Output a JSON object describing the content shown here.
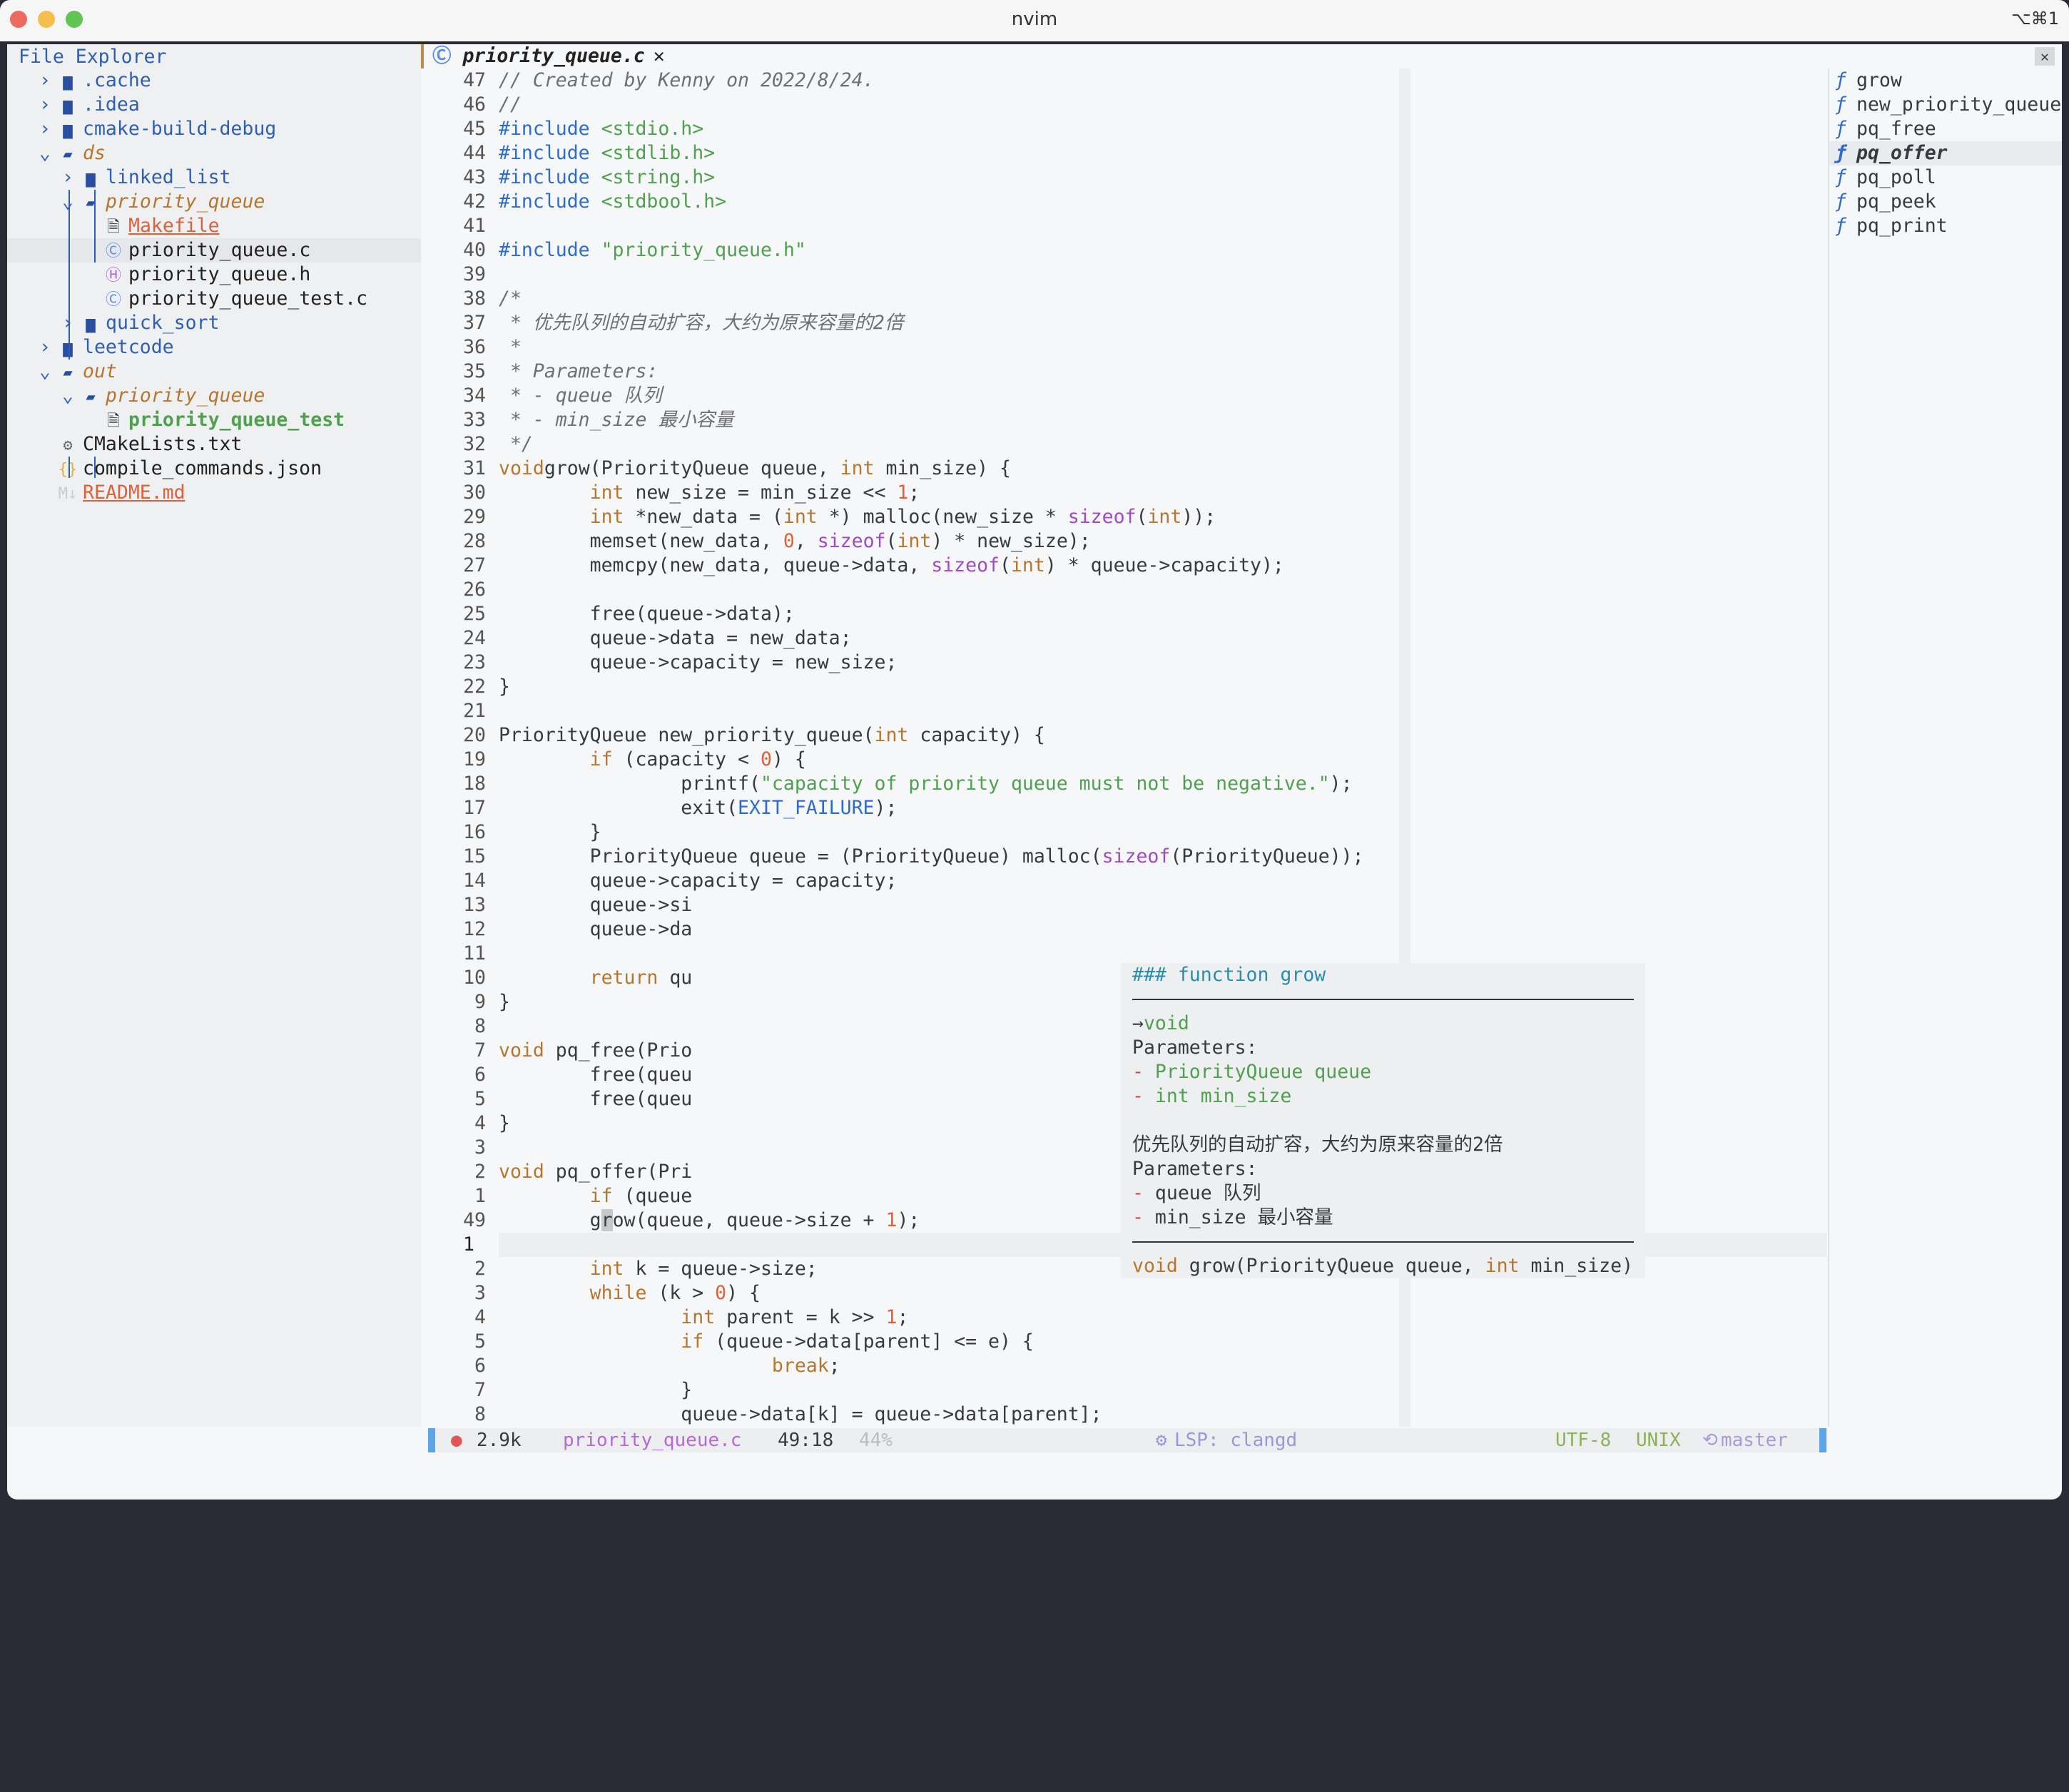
{
  "window": {
    "title": "nvim",
    "shortcut": "⌥⌘1",
    "lights": [
      "#ed6a5e",
      "#f5bf4f",
      "#61c554"
    ]
  },
  "explorer": {
    "title": "File Explorer",
    "items": [
      {
        "label": ".cache",
        "depth": 0,
        "chevron": "›",
        "icon": "folder",
        "color": "#2f5fb3"
      },
      {
        "label": ".idea",
        "depth": 0,
        "chevron": "›",
        "icon": "folder",
        "color": "#2f5fb3"
      },
      {
        "label": "cmake-build-debug",
        "depth": 0,
        "chevron": "›",
        "icon": "folder",
        "color": "#2f5fb3"
      },
      {
        "label": "ds",
        "depth": 0,
        "chevron": "⌄",
        "icon": "folder-open",
        "color": "#b7762e",
        "italic": true
      },
      {
        "label": "linked_list",
        "depth": 1,
        "chevron": "›",
        "icon": "folder",
        "color": "#2f5fb3"
      },
      {
        "label": "priority_queue",
        "depth": 1,
        "chevron": "⌄",
        "icon": "folder-open",
        "color": "#b7762e",
        "italic": true
      },
      {
        "label": "Makefile",
        "depth": 2,
        "chevron": "",
        "icon": "file",
        "color": "#e0603a",
        "underline": true
      },
      {
        "label": "priority_queue.c",
        "depth": 2,
        "chevron": "",
        "icon": "c-file",
        "color": "#222",
        "selected": true
      },
      {
        "label": "priority_queue.h",
        "depth": 2,
        "chevron": "",
        "icon": "h-file",
        "color": "#222"
      },
      {
        "label": "priority_queue_test.c",
        "depth": 2,
        "chevron": "",
        "icon": "c-file",
        "color": "#222"
      },
      {
        "label": "quick_sort",
        "depth": 1,
        "chevron": "›",
        "icon": "folder",
        "color": "#2f5fb3"
      },
      {
        "label": "leetcode",
        "depth": 0,
        "chevron": "›",
        "icon": "folder",
        "color": "#2f5fb3"
      },
      {
        "label": "out",
        "depth": 0,
        "chevron": "⌄",
        "icon": "folder-open",
        "color": "#b7762e",
        "italic": true
      },
      {
        "label": "priority_queue",
        "depth": 1,
        "chevron": "⌄",
        "icon": "folder-open",
        "color": "#b7762e",
        "italic": true
      },
      {
        "label": "priority_queue_test",
        "depth": 2,
        "chevron": "",
        "icon": "file",
        "color": "#50a14f",
        "bold": true
      },
      {
        "label": "CMakeLists.txt",
        "depth": 0,
        "chevron": "",
        "icon": "gear",
        "color": "#222"
      },
      {
        "label": "compile_commands.json",
        "depth": 0,
        "chevron": "",
        "icon": "json",
        "color": "#222"
      },
      {
        "label": "README.md",
        "depth": 0,
        "chevron": "",
        "icon": "markdown",
        "color": "#e0603a",
        "underline": true
      }
    ]
  },
  "tab": {
    "label": "priority_queue.c",
    "close": "✕",
    "close_all": "✕"
  },
  "code": {
    "current_index": 48,
    "lines": [
      {
        "n": "47",
        "t": [
          [
            "c",
            "// Created by Kenny on 2022/8/24."
          ]
        ]
      },
      {
        "n": "46",
        "t": [
          [
            "c",
            "//"
          ]
        ]
      },
      {
        "n": "45",
        "t": [
          [
            "p",
            "#include"
          ],
          [
            "s",
            " <stdio.h>"
          ]
        ]
      },
      {
        "n": "44",
        "t": [
          [
            "p",
            "#include"
          ],
          [
            "s",
            " <stdlib.h>"
          ]
        ]
      },
      {
        "n": "43",
        "t": [
          [
            "p",
            "#include"
          ],
          [
            "s",
            " <string.h>"
          ]
        ]
      },
      {
        "n": "42",
        "t": [
          [
            "p",
            "#include"
          ],
          [
            "s",
            " <stdbool.h>"
          ]
        ]
      },
      {
        "n": "41",
        "t": []
      },
      {
        "n": "40",
        "t": [
          [
            "p",
            "#include"
          ],
          [
            "s",
            " \"priority_queue.h\""
          ]
        ]
      },
      {
        "n": "39",
        "t": []
      },
      {
        "n": "38",
        "t": [
          [
            "c",
            "/*"
          ]
        ]
      },
      {
        "n": "37",
        "t": [
          [
            "c",
            " * 优先队列的自动扩容，大约为原来容量的2倍"
          ]
        ]
      },
      {
        "n": "36",
        "t": [
          [
            "c",
            " *"
          ]
        ]
      },
      {
        "n": "35",
        "t": [
          [
            "c",
            " * Parameters:"
          ]
        ]
      },
      {
        "n": "34",
        "t": [
          [
            "c",
            " * - queue 队列"
          ]
        ]
      },
      {
        "n": "33",
        "t": [
          [
            "c",
            " * - min_size 最小容量"
          ]
        ]
      },
      {
        "n": "32",
        "t": [
          [
            "c",
            " */"
          ]
        ]
      },
      {
        "n": "31",
        "t": [
          [
            "k",
            "void"
          ],
          [
            "",
            "grow(PriorityQueue queue, "
          ],
          [
            "k",
            "int"
          ],
          [
            "",
            " min_size) {"
          ]
        ]
      },
      {
        "n": "30",
        "t": [
          [
            "",
            "        "
          ],
          [
            "k",
            "int"
          ],
          [
            "",
            " new_size = min_size << "
          ],
          [
            "n",
            "1"
          ],
          [
            "",
            ";"
          ]
        ]
      },
      {
        "n": "29",
        "t": [
          [
            "",
            "        "
          ],
          [
            "k",
            "int"
          ],
          [
            "",
            " *new_data = ("
          ],
          [
            "k",
            "int"
          ],
          [
            "",
            " *) malloc(new_size * "
          ],
          [
            "b",
            "sizeof"
          ],
          [
            "",
            "("
          ],
          [
            "k",
            "int"
          ],
          [
            "",
            "));"
          ]
        ]
      },
      {
        "n": "28",
        "t": [
          [
            "",
            "        memset(new_data, "
          ],
          [
            "n",
            "0"
          ],
          [
            "",
            ", "
          ],
          [
            "b",
            "sizeof"
          ],
          [
            "",
            "("
          ],
          [
            "k",
            "int"
          ],
          [
            "",
            ") * new_size);"
          ]
        ]
      },
      {
        "n": "27",
        "t": [
          [
            "",
            "        memcpy(new_data, queue->data, "
          ],
          [
            "b",
            "sizeof"
          ],
          [
            "",
            "("
          ],
          [
            "k",
            "int"
          ],
          [
            "",
            ") * queue->capacity);"
          ]
        ]
      },
      {
        "n": "26",
        "t": []
      },
      {
        "n": "25",
        "t": [
          [
            "",
            "        free(queue->data);"
          ]
        ]
      },
      {
        "n": "24",
        "t": [
          [
            "",
            "        queue->data = new_data;"
          ]
        ]
      },
      {
        "n": "23",
        "t": [
          [
            "",
            "        queue->capacity = new_size;"
          ]
        ]
      },
      {
        "n": "22",
        "t": [
          [
            "",
            "}"
          ]
        ]
      },
      {
        "n": "21",
        "t": []
      },
      {
        "n": "20",
        "t": [
          [
            "",
            "PriorityQueue new_priority_queue("
          ],
          [
            "k",
            "int"
          ],
          [
            "",
            " capacity) {"
          ]
        ]
      },
      {
        "n": "19",
        "t": [
          [
            "",
            "        "
          ],
          [
            "k",
            "if"
          ],
          [
            "",
            " (capacity < "
          ],
          [
            "n",
            "0"
          ],
          [
            "",
            ") {"
          ]
        ]
      },
      {
        "n": "18",
        "t": [
          [
            "",
            "                printf("
          ],
          [
            "s",
            "\"capacity of priority queue must not be negative.\""
          ],
          [
            "",
            ");"
          ]
        ]
      },
      {
        "n": "17",
        "t": [
          [
            "",
            "                exit("
          ],
          [
            "m",
            "EXIT_FAILURE"
          ],
          [
            "",
            ");"
          ]
        ]
      },
      {
        "n": "16",
        "t": [
          [
            "",
            "        }"
          ]
        ]
      },
      {
        "n": "15",
        "t": [
          [
            "",
            "        PriorityQueue queue = (PriorityQueue) malloc("
          ],
          [
            "b",
            "sizeof"
          ],
          [
            "",
            "(PriorityQueue));"
          ]
        ]
      },
      {
        "n": "14",
        "t": [
          [
            "",
            "        queue->capacity = capacity;"
          ]
        ]
      },
      {
        "n": "13",
        "t": [
          [
            "",
            "        queue->si"
          ]
        ]
      },
      {
        "n": "12",
        "t": [
          [
            "",
            "        queue->da"
          ]
        ]
      },
      {
        "n": "11",
        "t": []
      },
      {
        "n": "10",
        "t": [
          [
            "",
            "        "
          ],
          [
            "k",
            "return"
          ],
          [
            "",
            " qu"
          ]
        ]
      },
      {
        "n": "9",
        "t": [
          [
            "",
            "}"
          ]
        ]
      },
      {
        "n": "8",
        "t": []
      },
      {
        "n": "7",
        "t": [
          [
            "k",
            "void"
          ],
          [
            "",
            " pq_free(Prio"
          ]
        ]
      },
      {
        "n": "6",
        "t": [
          [
            "",
            "        free(queu"
          ]
        ]
      },
      {
        "n": "5",
        "t": [
          [
            "",
            "        free(queu"
          ]
        ]
      },
      {
        "n": "4",
        "t": [
          [
            "",
            "}"
          ]
        ]
      },
      {
        "n": "3",
        "t": []
      },
      {
        "n": "2",
        "t": [
          [
            "k",
            "void"
          ],
          [
            "",
            " pq_offer(Pri"
          ]
        ]
      },
      {
        "n": "1",
        "t": [
          [
            "",
            "        "
          ],
          [
            "k",
            "if"
          ],
          [
            "",
            " (queue"
          ]
        ]
      },
      {
        "n": "49",
        "t": [
          [
            "",
            "        g"
          ],
          [
            "cursor",
            "r"
          ],
          [
            "",
            "ow(queue, queue->size + "
          ],
          [
            "n",
            "1"
          ],
          [
            "",
            ");"
          ]
        ]
      },
      {
        "n": "1",
        "t": []
      },
      {
        "n": "2",
        "t": [
          [
            "",
            "        "
          ],
          [
            "k",
            "int"
          ],
          [
            "",
            " k = queue->size;"
          ]
        ]
      },
      {
        "n": "3",
        "t": [
          [
            "",
            "        "
          ],
          [
            "k",
            "while"
          ],
          [
            "",
            " (k > "
          ],
          [
            "n",
            "0"
          ],
          [
            "",
            ") {"
          ]
        ]
      },
      {
        "n": "4",
        "t": [
          [
            "",
            "                "
          ],
          [
            "k",
            "int"
          ],
          [
            "",
            " parent = k >> "
          ],
          [
            "n",
            "1"
          ],
          [
            "",
            ";"
          ]
        ]
      },
      {
        "n": "5",
        "t": [
          [
            "",
            "                "
          ],
          [
            "k",
            "if"
          ],
          [
            "",
            " (queue->data[parent] <= e) {"
          ]
        ]
      },
      {
        "n": "6",
        "t": [
          [
            "",
            "                        "
          ],
          [
            "k",
            "break"
          ],
          [
            "",
            ";"
          ]
        ]
      },
      {
        "n": "7",
        "t": [
          [
            "",
            "                }"
          ]
        ]
      },
      {
        "n": "8",
        "t": [
          [
            "",
            "                queue->data[k] = queue->data[parent];"
          ]
        ]
      }
    ]
  },
  "hover": {
    "lines": [
      [
        [
          "teal",
          "### function grow"
        ]
      ],
      "sep",
      [
        [
          "",
          "→"
        ],
        [
          "grn",
          "void"
        ]
      ],
      [
        [
          "",
          "Parameters:"
        ]
      ],
      [
        [
          "red",
          "- "
        ],
        [
          "grn",
          "PriorityQueue queue"
        ]
      ],
      [
        [
          "red",
          "- "
        ],
        [
          "grn",
          "int min_size"
        ]
      ],
      [],
      [
        [
          "",
          "优先队列的自动扩容，大约为原来容量的2倍"
        ]
      ],
      [
        [
          "",
          "Parameters:"
        ]
      ],
      [
        [
          "red",
          "- "
        ],
        [
          "",
          "queue 队列"
        ]
      ],
      [
        [
          "red",
          "- "
        ],
        [
          "",
          "min_size 最小容量"
        ]
      ],
      "sep",
      [
        [
          "k",
          "void"
        ],
        [
          "",
          " grow(PriorityQueue queue, "
        ],
        [
          "k",
          "int"
        ],
        [
          "",
          " min_size)"
        ]
      ]
    ]
  },
  "outline": {
    "icon": "ƒ",
    "items": [
      {
        "label": "grow"
      },
      {
        "label": "new_priority_queue"
      },
      {
        "label": "pq_free"
      },
      {
        "label": "pq_offer",
        "active": true
      },
      {
        "label": "pq_poll"
      },
      {
        "label": "pq_peek"
      },
      {
        "label": "pq_print"
      }
    ]
  },
  "status": {
    "size": "2.9k",
    "file": "priority_queue.c",
    "position": "49:18",
    "percent": "44%",
    "lsp": "LSP: clangd",
    "encoding": "UTF-8",
    "format": "UNIX",
    "branch": "master",
    "colors": {
      "file": "#b36ad6",
      "lsp": "#9d95d8",
      "encoding": "#8db05a",
      "branch": "#a79ad8",
      "accent": "#5ba4e6"
    }
  }
}
